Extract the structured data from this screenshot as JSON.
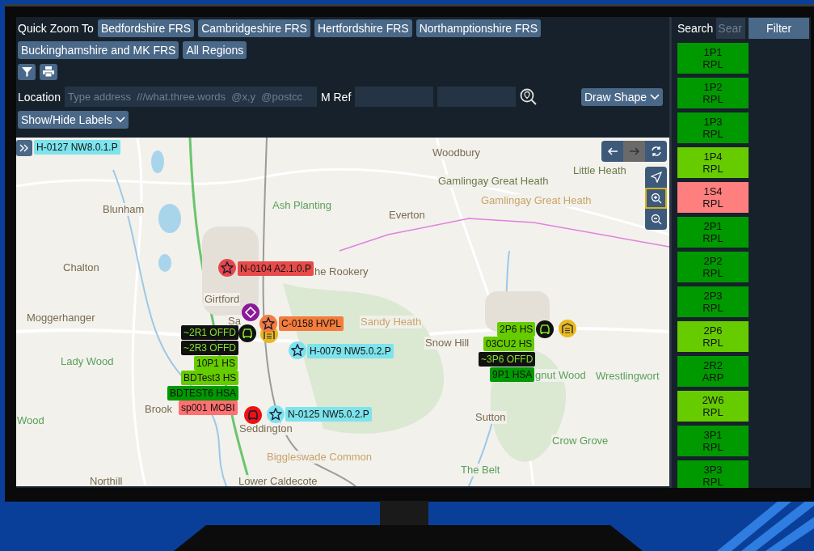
{
  "toolbar": {
    "quick_zoom_label": "Quick Zoom To",
    "regions": [
      "Bedfordshire FRS",
      "Cambridgeshire FRS",
      "Hertfordshire FRS",
      "Northamptionshire FRS",
      "Buckinghamshire and MK FRS",
      "All Regions"
    ],
    "location_label": "Location",
    "location_placeholder": "Type address  ///what.three.words  @x,y  @postcc",
    "mref_label": "M Ref",
    "draw_shape": "Draw Shape",
    "labels_toggle": "Show/Hide Labels"
  },
  "map": {
    "places": [
      {
        "name": "Woodbury",
        "kind": "town"
      },
      {
        "name": "Gamlingay Great Heath",
        "kind": "area"
      },
      {
        "name": "Little Heath",
        "kind": "area"
      },
      {
        "name": "Gamlingay Great Heath",
        "kind": "heath"
      },
      {
        "name": "Blunham",
        "kind": "town"
      },
      {
        "name": "Ash Planting",
        "kind": "wood"
      },
      {
        "name": "Everton",
        "kind": "town"
      },
      {
        "name": "Chalton",
        "kind": "town"
      },
      {
        "name": "he Rookery",
        "kind": "town"
      },
      {
        "name": "Girtford",
        "kind": "town"
      },
      {
        "name": "Moggerhanger",
        "kind": "town"
      },
      {
        "name": "Sa",
        "kind": "town"
      },
      {
        "name": "Sandy Heath",
        "kind": "heath"
      },
      {
        "name": "Snow Hill",
        "kind": "town"
      },
      {
        "name": "Lady Wood",
        "kind": "wood"
      },
      {
        "name": "gnut Wood",
        "kind": "wood"
      },
      {
        "name": "Wrestlingwort",
        "kind": "wood"
      },
      {
        "name": "Wood",
        "kind": "wood"
      },
      {
        "name": "Brook",
        "kind": "town"
      },
      {
        "name": "Seddington",
        "kind": "town"
      },
      {
        "name": "Sutton",
        "kind": "town"
      },
      {
        "name": "Crow Grove",
        "kind": "wood"
      },
      {
        "name": "Biggleswade Common",
        "kind": "heath"
      },
      {
        "name": "The Belt",
        "kind": "wood"
      },
      {
        "name": "Northill",
        "kind": "town"
      },
      {
        "name": "Lower Caldecote",
        "kind": "town"
      }
    ],
    "badges": [
      {
        "kind": "star",
        "color": "#e8474a"
      },
      {
        "kind": "diamond",
        "color": "#8a1a9a"
      },
      {
        "kind": "garage",
        "color": "#e8b820"
      },
      {
        "kind": "star",
        "color": "#f47c3c"
      },
      {
        "kind": "car",
        "color": "#111111"
      },
      {
        "kind": "star",
        "color": "#7de3ec"
      },
      {
        "kind": "car",
        "color": "#ee1111"
      },
      {
        "kind": "star",
        "color": "#7de3ec"
      },
      {
        "kind": "car",
        "color": "#111111"
      },
      {
        "kind": "garage",
        "color": "#e8b820"
      }
    ],
    "unit_labels": [
      {
        "text": "H-0127 NW8.0.1.P",
        "color": "#7de3ec"
      },
      {
        "text": "N-0104 A2.1.0.P",
        "color": "#e84a4a"
      },
      {
        "text": "C-0158 HVPL",
        "color": "#f47c3c"
      },
      {
        "text": "~2R1 OFFD",
        "color": "#111111"
      },
      {
        "text": "~2R3 OFFD",
        "color": "#111111"
      },
      {
        "text": "10P1 HS",
        "color": "#66cc00"
      },
      {
        "text": "BDTest3 HS",
        "color": "#66cc00"
      },
      {
        "text": "BDTEST6 HSA",
        "color": "#009900"
      },
      {
        "text": "sp001 MOBI",
        "color": "#ff7070"
      },
      {
        "text": "H-0079 NW5.0.2.P",
        "color": "#7de3ec"
      },
      {
        "text": "N-0125 NW5.0.2.P",
        "color": "#7de3ec"
      },
      {
        "text": "2P6 HS",
        "color": "#66cc00"
      },
      {
        "text": "03CU2 HS",
        "color": "#66cc00"
      },
      {
        "text": "~3P6 OFFD",
        "color": "#111111"
      },
      {
        "text": "9P1 HSA",
        "color": "#009900"
      }
    ],
    "nav_controls": [
      {
        "kind": "back",
        "disabled": false
      },
      {
        "kind": "forward",
        "disabled": true
      },
      {
        "kind": "refresh",
        "disabled": false
      }
    ],
    "zoom_controls": [
      {
        "kind": "locate",
        "selected": false
      },
      {
        "kind": "zoom_in",
        "selected": true
      },
      {
        "kind": "zoom_out",
        "selected": false
      }
    ]
  },
  "panel": {
    "search_label": "Search",
    "search_placeholder": "Sear",
    "filter": "Filter",
    "units": [
      {
        "code": "1P1",
        "type": "RPL",
        "color": "#009900"
      },
      {
        "code": "1P2",
        "type": "RPL",
        "color": "#009900"
      },
      {
        "code": "1P3",
        "type": "RPL",
        "color": "#009900"
      },
      {
        "code": "1P4",
        "type": "RPL",
        "color": "#66cc00"
      },
      {
        "code": "1S4",
        "type": "RPL",
        "color": "#ff7f7f"
      },
      {
        "code": "2P1",
        "type": "RPL",
        "color": "#009900"
      },
      {
        "code": "2P2",
        "type": "RPL",
        "color": "#009900"
      },
      {
        "code": "2P3",
        "type": "RPL",
        "color": "#009900"
      },
      {
        "code": "2P6",
        "type": "RPL",
        "color": "#66cc00"
      },
      {
        "code": "2R2",
        "type": "ARP",
        "color": "#009900"
      },
      {
        "code": "2W6",
        "type": "RPL",
        "color": "#66cc00"
      },
      {
        "code": "3P1",
        "type": "RPL",
        "color": "#009900"
      },
      {
        "code": "3P3",
        "type": "RPL",
        "color": "#009900"
      }
    ]
  }
}
